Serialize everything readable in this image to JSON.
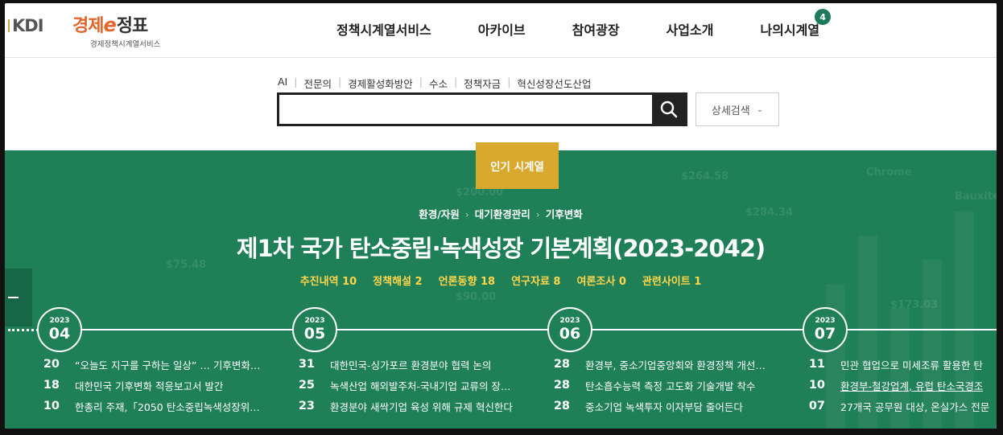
{
  "header": {
    "kdi_logo": "KDI",
    "brand_prefix": "경제",
    "brand_e": "e",
    "brand_suffix": "정표",
    "brand_sub": "경제정책시계열서비스",
    "nav": [
      "정책시계열서비스",
      "아카이브",
      "참여광장",
      "사업소개",
      "나의시계열"
    ],
    "my_badge": "4"
  },
  "search": {
    "quick_links": [
      "AI",
      "전문의",
      "경제활성화방안",
      "수소",
      "정책자금",
      "혁신성장선도산업"
    ],
    "input_value": "",
    "placeholder": "",
    "detail_label": "상세검색",
    "icon": "search-icon"
  },
  "hero": {
    "popular_label": "인기 시계열",
    "breadcrumb": [
      "환경/자원",
      "대기환경관리",
      "기후변화"
    ],
    "title": "제1차 국가 탄소중립·녹색성장 기본계획(2023-2042)",
    "stats": [
      "추진내역 10",
      "정책해설 2",
      "언론동향 18",
      "연구자료 8",
      "여론조사 0",
      "관련사이트 1"
    ],
    "colors": {
      "bg": "#1f7f57",
      "accent": "#d8a92e",
      "stat": "#ffd54a"
    }
  },
  "timeline": [
    {
      "year": "2023",
      "month": "04",
      "items": [
        {
          "day": "20",
          "text": "“오늘도 지구를 구하는 일상” … 기후변화…"
        },
        {
          "day": "18",
          "text": "대한민국 기후변화 적응보고서 발간"
        },
        {
          "day": "10",
          "text": "한총리 주재,「2050 탄소중립녹색성장위…"
        }
      ]
    },
    {
      "year": "2023",
      "month": "05",
      "items": [
        {
          "day": "31",
          "text": "대한민국-싱가포르 환경분야 협력 논의"
        },
        {
          "day": "25",
          "text": "녹색산업 해외발주처-국내기업 교류의 장…"
        },
        {
          "day": "23",
          "text": "환경분야 새싹기업 육성 위해 규제 혁신한다"
        }
      ]
    },
    {
      "year": "2023",
      "month": "06",
      "items": [
        {
          "day": "28",
          "text": "환경부, 중소기업중앙회와 환경정책 개선…"
        },
        {
          "day": "28",
          "text": "탄소흡수능력 측정 고도화 기술개발 착수"
        },
        {
          "day": "28",
          "text": "중소기업 녹색투자 이자부담 줄어든다"
        }
      ]
    },
    {
      "year": "2023",
      "month": "07",
      "items": [
        {
          "day": "11",
          "text": "민관 협업으로 미세조류 활용한 탄"
        },
        {
          "day": "10",
          "text": "환경부-철강업계, 유럽 탄소국경조"
        },
        {
          "day": "07",
          "text": "27개국 공무원 대상, 온실가스 전문"
        }
      ]
    }
  ]
}
